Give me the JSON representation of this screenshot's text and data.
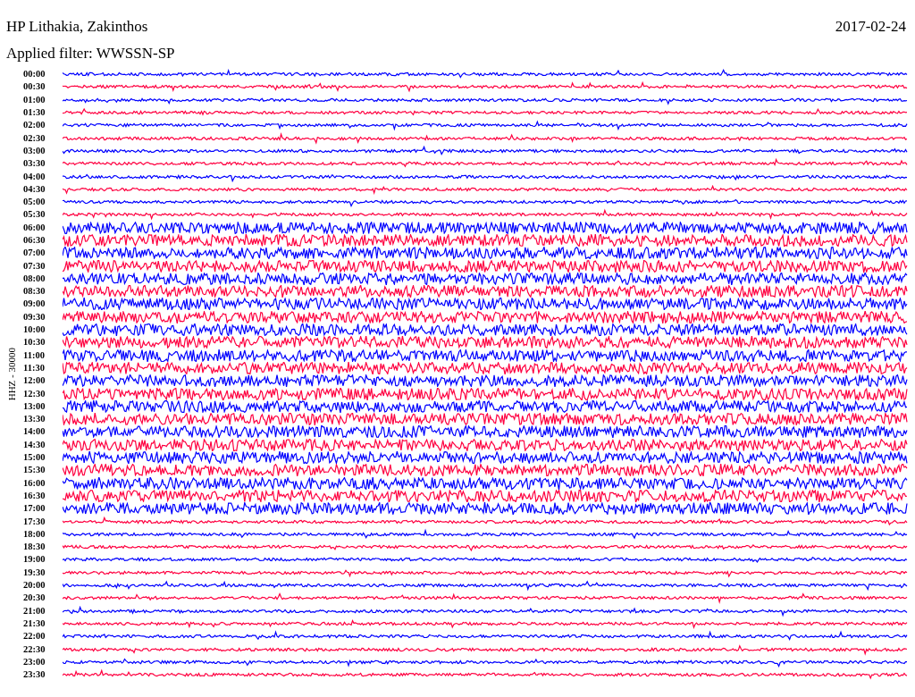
{
  "header": {
    "station": "HP Lithakia, Zakinthos",
    "date": "2017-02-24",
    "filter": "Applied filter: WWSSN-SP"
  },
  "channel_label": "HHZ - 30000",
  "rows": [
    {
      "time": "00:00",
      "color": "#0000ff"
    },
    {
      "time": "00:30",
      "color": "#ff0040"
    },
    {
      "time": "01:00",
      "color": "#0000ff"
    },
    {
      "time": "01:30",
      "color": "#ff0040"
    },
    {
      "time": "02:00",
      "color": "#0000ff"
    },
    {
      "time": "02:30",
      "color": "#ff0040"
    },
    {
      "time": "03:00",
      "color": "#0000ff"
    },
    {
      "time": "03:30",
      "color": "#ff0040"
    },
    {
      "time": "04:00",
      "color": "#0000ff"
    },
    {
      "time": "04:30",
      "color": "#ff0040"
    },
    {
      "time": "05:00",
      "color": "#0000ff"
    },
    {
      "time": "05:30",
      "color": "#ff0040"
    },
    {
      "time": "06:00",
      "color": "#0000ff"
    },
    {
      "time": "06:30",
      "color": "#ff0040"
    },
    {
      "time": "07:00",
      "color": "#0000ff"
    },
    {
      "time": "07:30",
      "color": "#ff0040"
    },
    {
      "time": "08:00",
      "color": "#0000ff"
    },
    {
      "time": "08:30",
      "color": "#ff0040"
    },
    {
      "time": "09:00",
      "color": "#0000ff"
    },
    {
      "time": "09:30",
      "color": "#ff0040"
    },
    {
      "time": "10:00",
      "color": "#0000ff"
    },
    {
      "time": "10:30",
      "color": "#ff0040"
    },
    {
      "time": "11:00",
      "color": "#0000ff"
    },
    {
      "time": "11:30",
      "color": "#ff0040"
    },
    {
      "time": "12:00",
      "color": "#0000ff"
    },
    {
      "time": "12:30",
      "color": "#ff0040"
    },
    {
      "time": "13:00",
      "color": "#0000ff"
    },
    {
      "time": "13:30",
      "color": "#ff0040"
    },
    {
      "time": "14:00",
      "color": "#0000ff"
    },
    {
      "time": "14:30",
      "color": "#ff0040"
    },
    {
      "time": "15:00",
      "color": "#0000ff"
    },
    {
      "time": "15:30",
      "color": "#ff0040"
    },
    {
      "time": "16:00",
      "color": "#0000ff"
    },
    {
      "time": "16:30",
      "color": "#ff0040"
    },
    {
      "time": "17:00",
      "color": "#0000ff"
    },
    {
      "time": "17:30",
      "color": "#ff0040"
    },
    {
      "time": "18:00",
      "color": "#0000ff"
    },
    {
      "time": "18:30",
      "color": "#ff0040"
    },
    {
      "time": "19:00",
      "color": "#0000ff"
    },
    {
      "time": "19:30",
      "color": "#ff0040"
    },
    {
      "time": "20:00",
      "color": "#0000ff"
    },
    {
      "time": "20:30",
      "color": "#ff0040"
    },
    {
      "time": "21:00",
      "color": "#0000ff"
    },
    {
      "time": "21:30",
      "color": "#ff0040"
    },
    {
      "time": "22:00",
      "color": "#0000ff"
    },
    {
      "time": "22:30",
      "color": "#ff0040"
    },
    {
      "time": "23:00",
      "color": "#0000ff"
    },
    {
      "time": "23:30",
      "color": "#ff0040"
    }
  ]
}
